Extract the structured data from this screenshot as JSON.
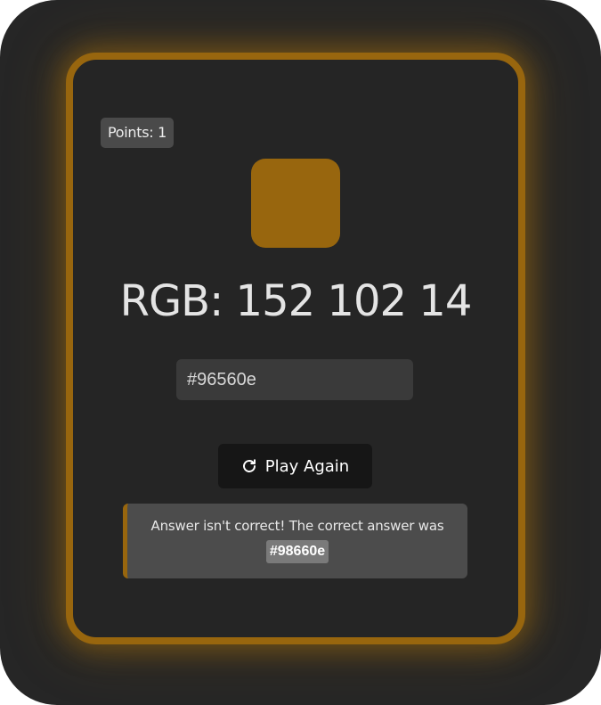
{
  "game": {
    "points_label": "Points: 1",
    "target_color": "#98660e",
    "rgb_label": "RGB: 152 102 14",
    "guess_value": "#96560e",
    "play_again_label": "Play Again",
    "result_message": "Answer isn't correct! The correct answer was",
    "correct_answer": "#98660e"
  },
  "colors": {
    "accent": "#98660e",
    "background": "#262626",
    "card": "#252525",
    "button": "#161616"
  },
  "icons": {
    "play_again": "refresh-icon"
  }
}
